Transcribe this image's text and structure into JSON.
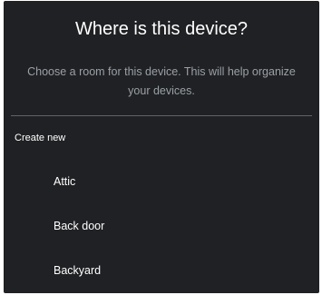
{
  "dialog": {
    "title": "Where is this device?",
    "subtitle": "Choose a room for this device. This will help organize your devices.",
    "section_header": "Create new",
    "rooms": [
      {
        "label": "Attic"
      },
      {
        "label": "Back door"
      },
      {
        "label": "Backyard"
      }
    ]
  },
  "colors": {
    "background": "#202124",
    "text_primary": "#ffffff",
    "text_secondary": "#9aa0a6",
    "divider": "#5f6368"
  }
}
